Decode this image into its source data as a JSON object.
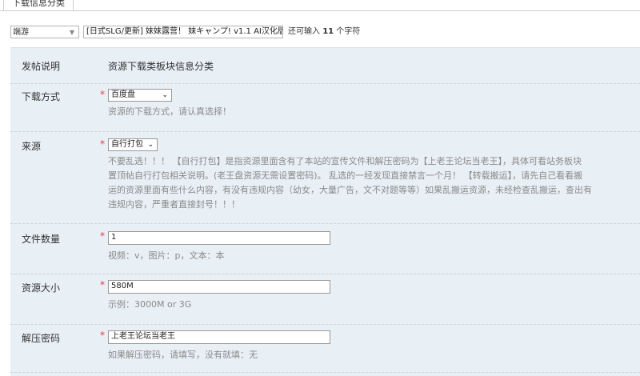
{
  "tab": {
    "label": "下载信息分类"
  },
  "title_row": {
    "type_select": "端游",
    "subject": "[日式SLG/更新] 妹妹露营！ 妹キャンプ! v1.1 AI汉化版",
    "remain_prefix": "还可输入",
    "remain_count": "11",
    "remain_suffix": "个字符"
  },
  "form": {
    "post_note": {
      "label": "发帖说明",
      "value": "资源下载类板块信息分类"
    },
    "download": {
      "label": "下载方式",
      "required": "*",
      "selected": "百度盘",
      "hint": "资源的下载方式，请认真选择！"
    },
    "source": {
      "label": "来源",
      "required": "*",
      "selected": "自行打包",
      "hint_lines": [
        "不要乱选！！！ 【自行打包】是指资源里面含有了本站的宣传文件和解压密码为【上老王论坛当老王】，具体可看站务板块",
        "置顶帖自行打包相关说明。(老王盘资源无需设置密码)。 乱选的一经发现直接禁言一个月！ 【转载搬运】，请先自己看看搬",
        "运的资源里面有些什么内容，有没有违规内容（幼女，大量广告，文不对题等等）如果乱搬运资源，未经检查乱搬运，查出有",
        "违规内容，严重者直接封号！！！"
      ]
    },
    "file_count": {
      "label": "文件数量",
      "required": "*",
      "value": "1",
      "hint": "视频：v，图片：p，文本：本"
    },
    "size": {
      "label": "资源大小",
      "required": "*",
      "value": "580M",
      "hint": "示例：3000M or 3G"
    },
    "password": {
      "label": "解压密码",
      "required": "*",
      "value": "上老王论坛当老王",
      "hint": "如果解压密码，请填写，没有就填：无"
    }
  },
  "colors": {
    "required": "#e4393c",
    "panel_bg": "#e8eff5",
    "hint": "#8a8a8a"
  }
}
